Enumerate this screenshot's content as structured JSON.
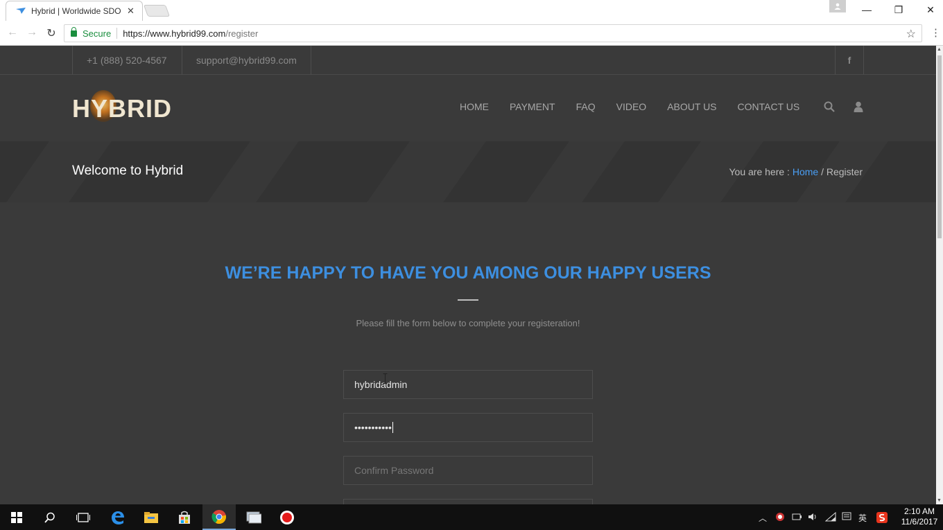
{
  "browser": {
    "tab_title": "Hybrid | Worldwide SDO",
    "secure_label": "Secure",
    "url_host": "https://www.hybrid99.com",
    "url_path": "/register"
  },
  "topbar": {
    "phone": "+1 (888) 520-4567",
    "email": "support@hybrid99.com",
    "facebook": "f"
  },
  "header": {
    "logo_text": "HYBRID",
    "nav": [
      "HOME",
      "PAYMENT",
      "FAQ",
      "VIDEO",
      "ABOUT US",
      "CONTACT US"
    ]
  },
  "title_band": {
    "title": "Welcome to Hybrid",
    "breadcrumb_prefix": "You are here : ",
    "breadcrumb_home": "Home",
    "breadcrumb_sep": " / ",
    "breadcrumb_current": "Register"
  },
  "register": {
    "headline": "WE’RE HAPPY TO HAVE YOU AMONG OUR HAPPY USERS",
    "subtext": "Please fill the form below to complete your registeration!",
    "username_value": "hybridadmin",
    "password_value": "•••••••••••",
    "confirm_placeholder": "Confirm Password"
  },
  "taskbar": {
    "ime": "英",
    "time": "2:10 AM",
    "date": "11/6/2017"
  },
  "colors": {
    "accent_blue": "#3d8fe0",
    "page_bg": "#3a3a3a",
    "secure_green": "#1a8e3e"
  }
}
